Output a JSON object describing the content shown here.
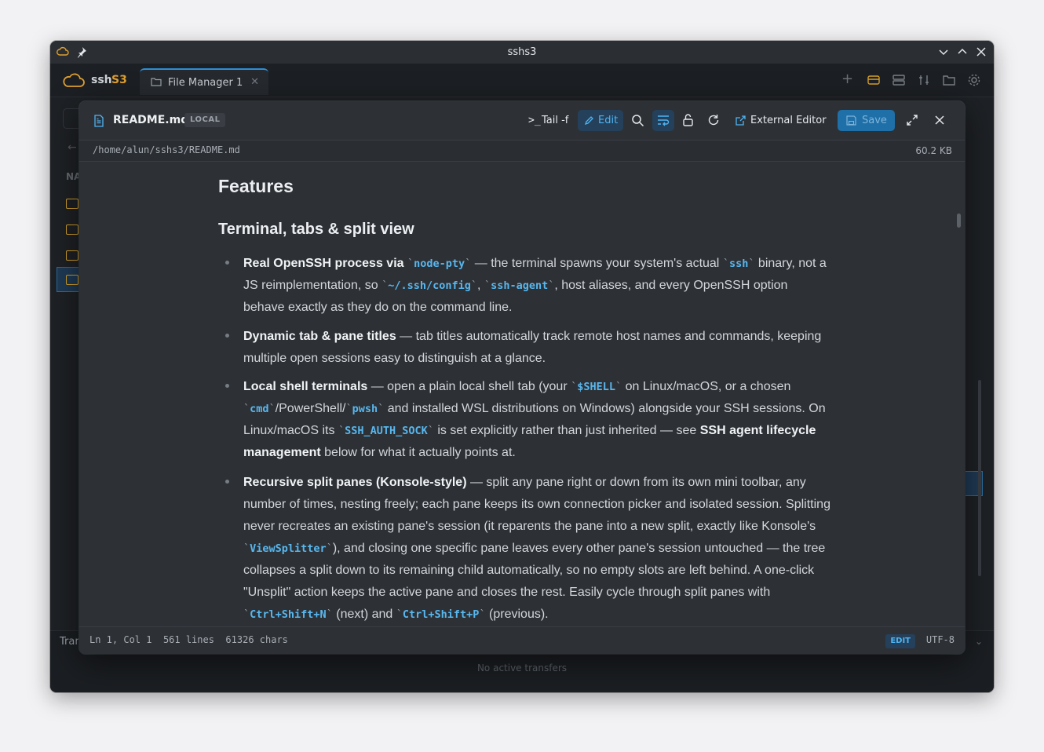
{
  "window": {
    "title": "sshs3"
  },
  "app": {
    "brand_primary": "ssh",
    "brand_accent": "S3",
    "tab": {
      "label": "File Manager 1"
    }
  },
  "transfers": {
    "label": "Tran",
    "empty_text": "No active transfers"
  },
  "editor": {
    "file_name": "README.md",
    "source_badge": "LOCAL",
    "buttons": {
      "tail": "Tail -f",
      "edit": "Edit",
      "external": "External Editor",
      "save": "Save"
    },
    "path": "/home/alun/sshs3/README.md",
    "file_size": "60.2 KB",
    "status": {
      "position": "Ln 1, Col 1",
      "lines": "561 lines",
      "chars": "61326 chars",
      "mode": "EDIT",
      "encoding": "UTF-8"
    }
  },
  "document": {
    "h1": "Features",
    "h2": "Terminal, tabs & split view",
    "items": [
      {
        "bold": "Real OpenSSH process via",
        "text": "Real OpenSSH process via `node-pty` — the terminal spawns your system's actual `ssh` binary, not a JS reimplementation, so `~/.ssh/config`, `ssh-agent`, host aliases, and every OpenSSH option behave exactly as they do on the command line."
      },
      {
        "bold": "Dynamic tab & pane titles",
        "text": "Dynamic tab & pane titles — tab titles automatically track remote host names and commands, keeping multiple open sessions easy to distinguish at a glance."
      },
      {
        "bold": "Local shell terminals",
        "text": "Local shell terminals — open a plain local shell tab (your `$SHELL` on Linux/macOS, or a chosen `cmd`/PowerShell/`pwsh` and installed WSL distributions on Windows) alongside your SSH sessions. On Linux/macOS its `SSH_AUTH_SOCK` is set explicitly rather than just inherited — see SSH agent lifecycle management below for what it actually points at."
      },
      {
        "bold": "Recursive split panes (Konsole-style)",
        "text": "Recursive split panes (Konsole-style) — split any pane right or down from its own mini toolbar, any number of times, nesting freely; each pane keeps its own connection picker and isolated session. Splitting never recreates an existing pane's session (it reparents the pane into a new split, exactly like Konsole's `ViewSplitter`), and closing one specific pane leaves every other pane's session untouched — the tree collapses a split down to its remaining child automatically, so no empty slots are left behind. A one-click \"Unsplit\" action keeps the active pane and closes the rest. Easily cycle through split panes with `Ctrl+Shift+N` (next) and `Ctrl+Shift+P` (previous)."
      }
    ]
  },
  "colors": {
    "accent": "#2b8fd6",
    "brand_accent": "#e0a030",
    "code": "#58b7ee",
    "dialog_bg": "#2d3136"
  },
  "icons": {
    "title_left": [
      "cloud-icon",
      "pin-icon"
    ],
    "title_right": [
      "minimize-icon",
      "maximize-icon",
      "close-icon"
    ],
    "editor": [
      "file-icon",
      "terminal-icon",
      "pencil-icon",
      "search-icon",
      "wrap-icon",
      "unlock-icon",
      "refresh-icon",
      "external-link-icon",
      "save-icon",
      "fullscreen-icon",
      "close-icon"
    ]
  }
}
